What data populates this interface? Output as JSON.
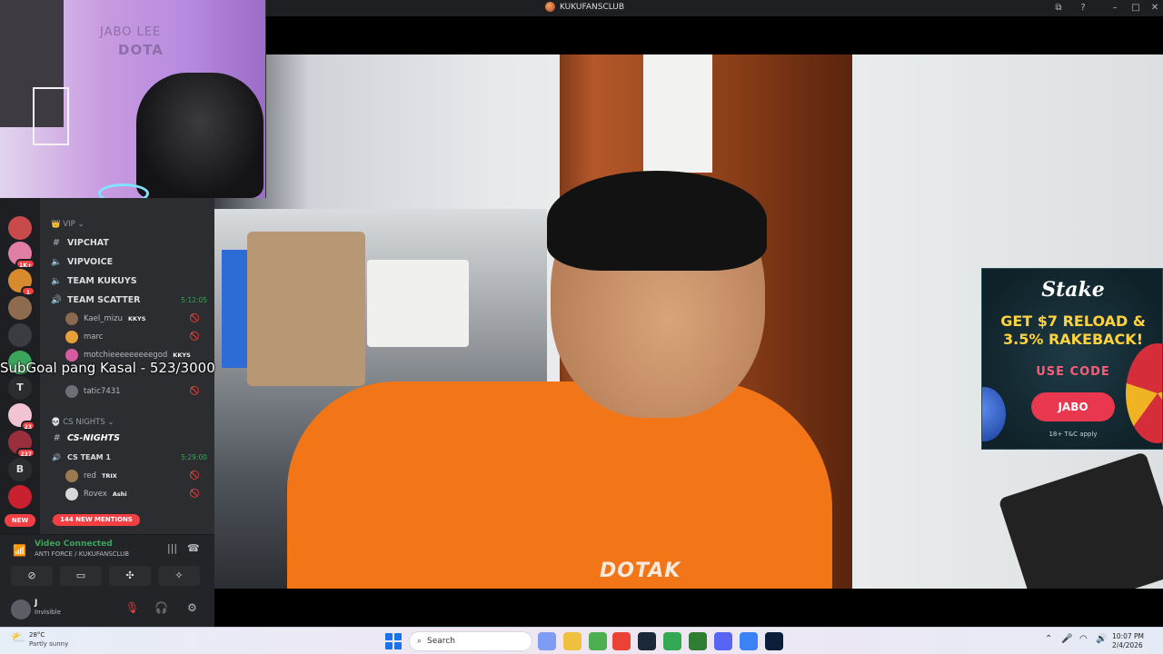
{
  "window": {
    "title": "KUKUFANSCLUB"
  },
  "webcam": {
    "sign_top": "JABO LEE",
    "sign_bottom": "DOTA"
  },
  "overlay": {
    "subgoal": "SubGoal pang Kasal - 523/3000"
  },
  "servers": {
    "badges": [
      "1K+",
      "1",
      "23",
      "237"
    ],
    "letters": [
      "T",
      "B"
    ],
    "new_label": "NEW"
  },
  "channels": {
    "vip_category": "VIP",
    "vipchat": "VIPCHAT",
    "vipvoice": "VIPVOICE",
    "team_kukuys": "TEAM KUKUYS",
    "team_scatter": "TEAM SCATTER",
    "team_scatter_time": "5:12:05",
    "scatter_users": [
      {
        "name": "Kael_mizu",
        "tag": "KKYS"
      },
      {
        "name": "marc",
        "tag": ""
      },
      {
        "name": "motchieeeeeeeeegod",
        "tag": "KKYS"
      },
      {
        "name": "tatic7431",
        "tag": ""
      }
    ],
    "cs_category": "CS NIGHTS",
    "cs_nights": "CS-NIGHTS",
    "cs_team": "CS TEAM 1",
    "cs_team_time": "5:29:00",
    "cs_users": [
      {
        "name": "red",
        "tag": "TRIX"
      },
      {
        "name": "Rovex",
        "tag": "Ashi"
      }
    ],
    "cs_partial": "CS",
    "mentions": "144 NEW MENTIONS"
  },
  "voice": {
    "status": "Video Connected",
    "location": "ANTI FORCE / KUKUFANSCLUB"
  },
  "user": {
    "name": "J",
    "status": "Invisible"
  },
  "ad": {
    "brand": "Stake",
    "headline": "GET $7 RELOAD & 3.5% RAKEBACK!",
    "code_label": "USE CODE",
    "code": "JABO",
    "terms": "18+ T&C apply"
  },
  "video": {
    "shirt_text": "DOTAK"
  },
  "taskbar": {
    "weather_temp": "28°C",
    "weather_desc": "Partly sunny",
    "search_placeholder": "Search",
    "time": "10:07 PM",
    "date": "2/4/2026"
  }
}
